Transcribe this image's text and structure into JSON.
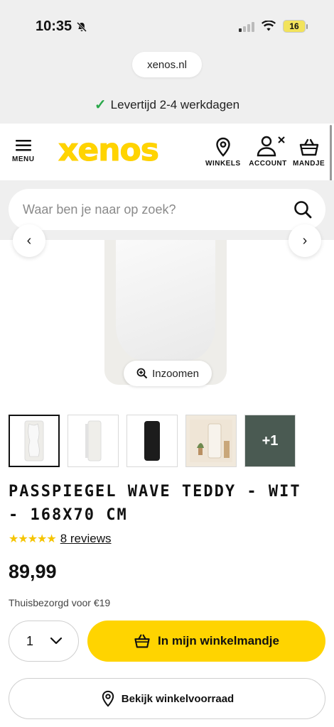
{
  "status_bar": {
    "time": "10:35",
    "battery": "16"
  },
  "browser": {
    "url": "xenos.nl"
  },
  "delivery_banner": {
    "text": "Levertijd 2-4 werkdagen",
    "check_color": "#2aa84a"
  },
  "header": {
    "logo": "xenos",
    "logo_color": "#ffd400",
    "menu_label": "MENU",
    "stores_label": "WINKELS",
    "account_label": "ACCOUNT",
    "basket_label": "MANDJE"
  },
  "search": {
    "placeholder": "Waar ben je naar op zoek?"
  },
  "gallery": {
    "zoom_label": "Inzoomen",
    "more_label": "+1"
  },
  "product": {
    "title": "PASSPIEGEL WAVE TEDDY - WIT - 168X70 CM",
    "rating_stars": 5,
    "reviews_label": "8 reviews",
    "price": "89,99",
    "delivery_cost": "Thuisbezorgd voor €19"
  },
  "actions": {
    "quantity": "1",
    "add_to_cart": "In mijn winkelmandje",
    "add_to_cart_color": "#ffd400",
    "store_stock": "Bekijk winkelvoorraad"
  }
}
